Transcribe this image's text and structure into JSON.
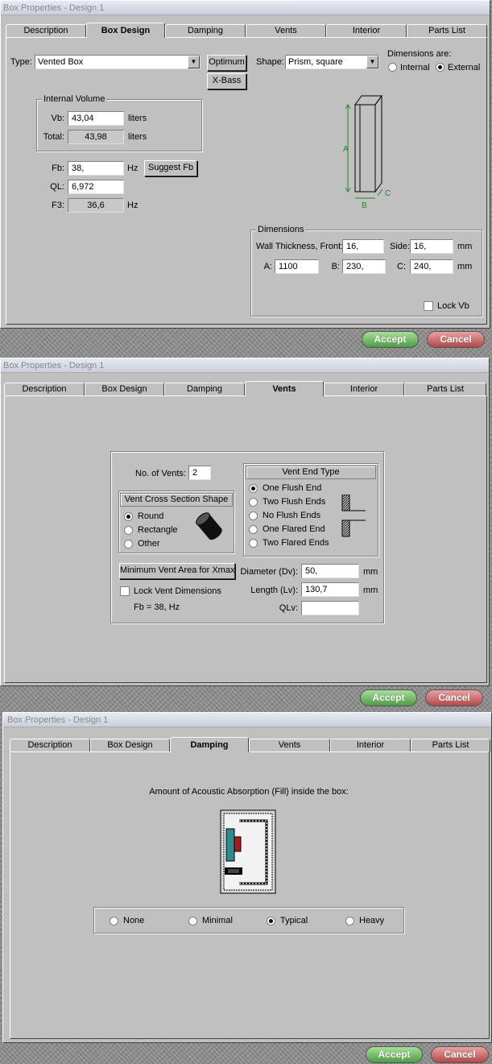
{
  "tabs": [
    "Description",
    "Box Design",
    "Damping",
    "Vents",
    "Interior",
    "Parts List"
  ],
  "title1": "Box Properties - Design 1",
  "accept": "Accept",
  "cancel": "Cancel",
  "d1": {
    "type_label": "Type:",
    "type_value": "Vented Box",
    "optimum": "Optimum",
    "xbass": "X-Bass",
    "shape_label": "Shape:",
    "shape_value": "Prism, square",
    "dims_are": "Dimensions are:",
    "internal": "Internal",
    "external": "External",
    "iv_title": "Internal Volume",
    "vb_label": "Vb:",
    "vb": "43,04",
    "liters": "liters",
    "total_label": "Total:",
    "total": "43,98",
    "fb_label": "Fb:",
    "fb": "38,",
    "hz": "Hz",
    "suggest": "Suggest Fb",
    "ql_label": "QL:",
    "ql": "6,972",
    "f3_label": "F3:",
    "f3": "36,6",
    "dim_title": "Dimensions",
    "wall_label": "Wall Thickness, Front:",
    "wall": "16,",
    "side_label": "Side:",
    "side": "16,",
    "mm": "mm",
    "a_label": "A:",
    "a": "1100",
    "b_label": "B:",
    "b": "230,",
    "c_label": "C:",
    "c": "240,",
    "lock": "Lock Vb",
    "dim_a": "A",
    "dim_b": "B",
    "dim_c": "C"
  },
  "d2": {
    "nvents_label": "No. of Vents:",
    "nvents": "2",
    "xsec_title": "Vent Cross Section Shape",
    "round": "Round",
    "rect": "Rectangle",
    "other": "Other",
    "endtype_title": "Vent End Type",
    "e1": "One Flush End",
    "e2": "Two Flush Ends",
    "e3": "No Flush Ends",
    "e4": "One Flared End",
    "e5": "Two Flared Ends",
    "minvent": "Minimum Vent Area for Xmax",
    "lockvent": "Lock Vent Dimensions",
    "fbinfo": "Fb = 38, Hz",
    "dia_label": "Diameter (Dv):",
    "dia": "50,",
    "len_label": "Length (Lv):",
    "len": "130,7",
    "qlv_label": "QLv:",
    "qlv": "",
    "mm": "mm"
  },
  "d3": {
    "heading": "Amount of Acoustic Absorption (Fill) inside the box:",
    "none": "None",
    "minimal": "Minimal",
    "typical": "Typical",
    "heavy": "Heavy"
  }
}
